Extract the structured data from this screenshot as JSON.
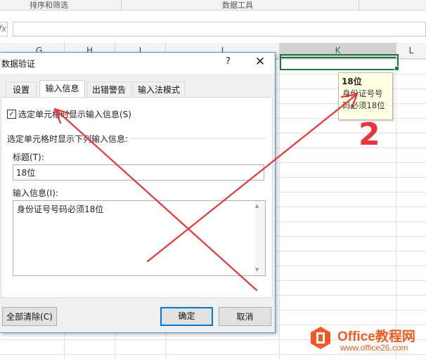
{
  "ribbon": {
    "groups": [
      "排序和筛选",
      "数据工具"
    ]
  },
  "formula_bar": {
    "fx_label": "fx",
    "value": ""
  },
  "columns": [
    "G",
    "H",
    "I",
    "J",
    "K",
    "L"
  ],
  "tooltip": {
    "title": "18位",
    "message": "身份证号号码必须18位"
  },
  "dialog": {
    "title": "数据验证",
    "help": "?",
    "close": "✕",
    "tabs": [
      "设置",
      "输入信息",
      "出错警告",
      "输入法模式"
    ],
    "active_tab": "输入信息",
    "checkbox": {
      "label": "选定单元格时显示输入信息(S)",
      "checked": true
    },
    "group_label": "选定单元格时显示下列输入信息:",
    "title_label": "标题(T):",
    "title_value": "18位",
    "message_label": "输入信息(I):",
    "message_value": "身份证号号码必须18位",
    "buttons": {
      "clear_all": "全部清除(C)",
      "ok": "确定",
      "cancel": "取消"
    }
  },
  "annotation": {
    "number": "2"
  },
  "watermark": {
    "name": "Office教程网",
    "url": "www.office26.com"
  },
  "colors": {
    "accent": "#217346",
    "annotation": "#e8343a",
    "watermark": "#f15a22"
  }
}
